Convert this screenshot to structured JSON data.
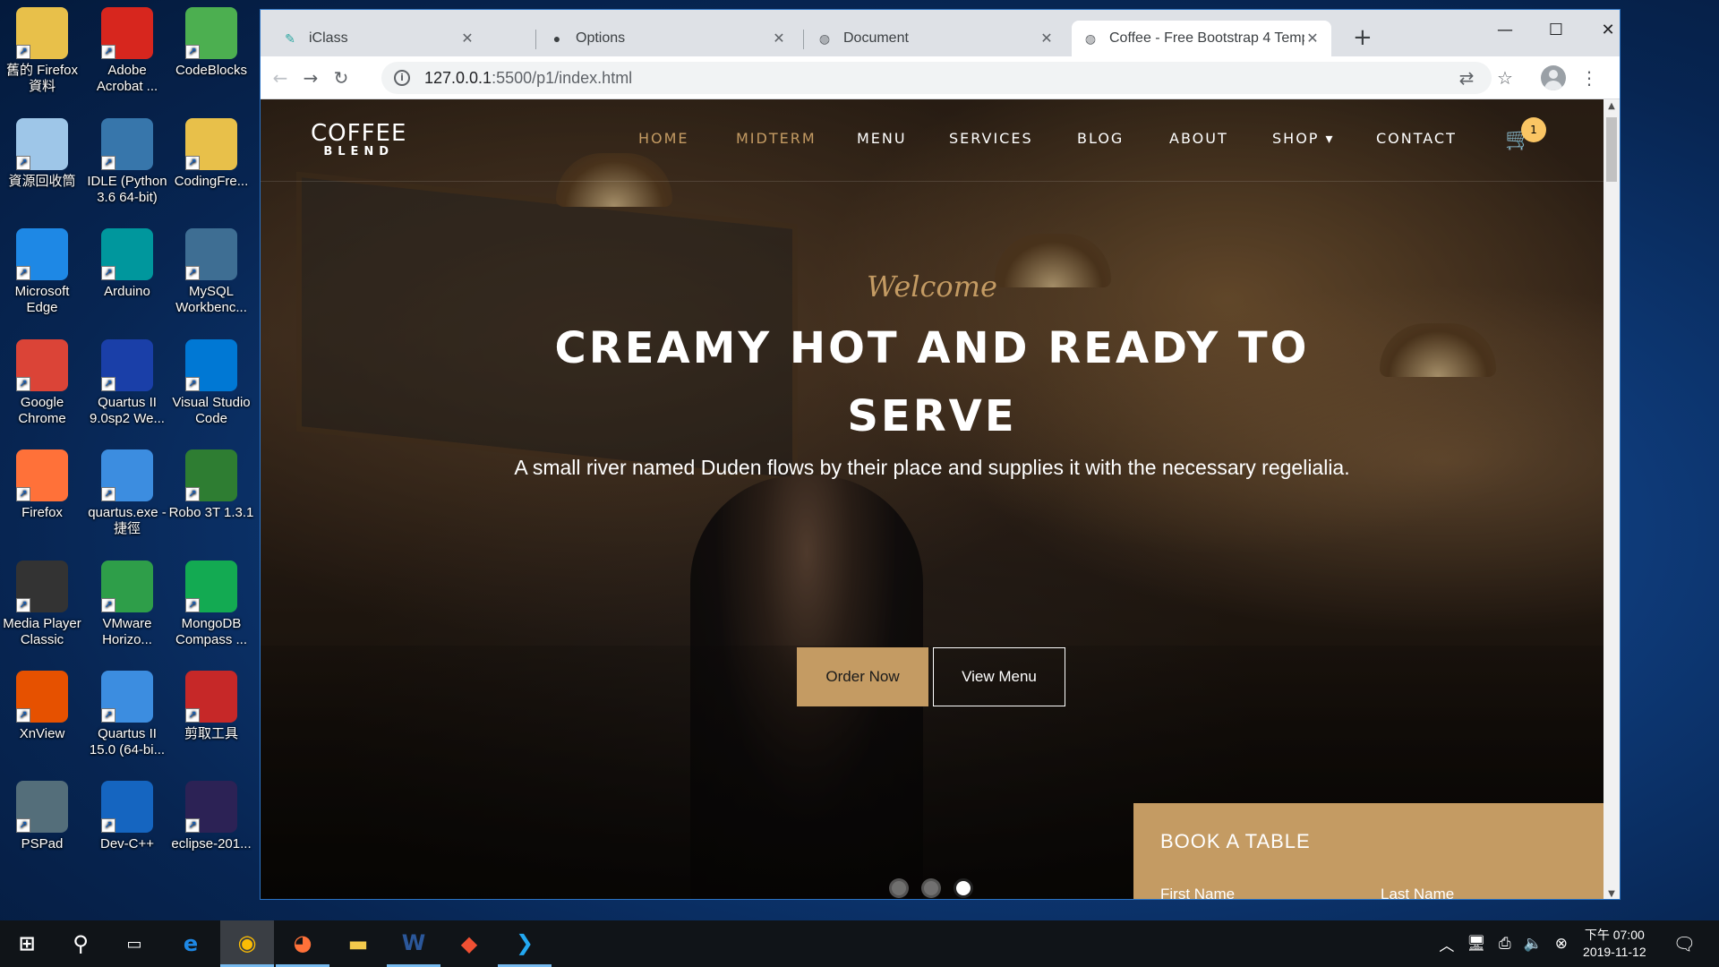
{
  "desktop": {
    "icons": [
      {
        "label": "舊的 Firefox 資料",
        "icon": "folder-icon",
        "color": "#e8c04a"
      },
      {
        "label": "Adobe Acrobat ...",
        "icon": "acrobat-icon",
        "color": "#d7261e"
      },
      {
        "label": "CodeBlocks",
        "icon": "codeblocks-icon",
        "color": "#4caf50"
      },
      {
        "label": "資源回收筒",
        "icon": "recycle-bin-icon",
        "color": "#9ec6e8"
      },
      {
        "label": "IDLE (Python 3.6 64-bit)",
        "icon": "python-icon",
        "color": "#3776ab"
      },
      {
        "label": "CodingFre...",
        "icon": "folder-icon",
        "color": "#e8c04a"
      },
      {
        "label": "Microsoft Edge",
        "icon": "edge-icon",
        "color": "#1e88e5"
      },
      {
        "label": "Arduino",
        "icon": "arduino-icon",
        "color": "#00979d"
      },
      {
        "label": "MySQL Workbenc...",
        "icon": "mysql-icon",
        "color": "#3e6e93"
      },
      {
        "label": "Google Chrome",
        "icon": "chrome-icon",
        "color": "#db4437"
      },
      {
        "label": "Quartus II 9.0sp2 We...",
        "icon": "quartus-icon",
        "color": "#1a3fa8"
      },
      {
        "label": "Visual Studio Code",
        "icon": "vscode-icon",
        "color": "#0078d4"
      },
      {
        "label": "Firefox",
        "icon": "firefox-icon",
        "color": "#ff7139"
      },
      {
        "label": "quartus.exe - 捷徑",
        "icon": "quartus-icon",
        "color": "#3c8de0"
      },
      {
        "label": "Robo 3T 1.3.1",
        "icon": "robo3t-icon",
        "color": "#2e7d32"
      },
      {
        "label": "Media Player Classic",
        "icon": "media-player-icon",
        "color": "#333333"
      },
      {
        "label": "VMware Horizo...",
        "icon": "vmware-icon",
        "color": "#2e9e49"
      },
      {
        "label": "MongoDB Compass ...",
        "icon": "mongodb-icon",
        "color": "#13aa52"
      },
      {
        "label": "XnView",
        "icon": "xnview-icon",
        "color": "#e65100"
      },
      {
        "label": "Quartus II 15.0 (64-bi...",
        "icon": "quartus-icon",
        "color": "#3c8de0"
      },
      {
        "label": "剪取工具",
        "icon": "snipping-tool-icon",
        "color": "#c62828"
      },
      {
        "label": "PSPad",
        "icon": "pspad-icon",
        "color": "#546e7a"
      },
      {
        "label": "Dev-C++",
        "icon": "devcpp-icon",
        "color": "#1565c0"
      },
      {
        "label": "eclipse-201...",
        "icon": "eclipse-icon",
        "color": "#2c2255"
      }
    ]
  },
  "browser": {
    "tabs": [
      {
        "title": "iClass",
        "icon": "iclass-icon"
      },
      {
        "title": "Options",
        "icon": "github-icon"
      },
      {
        "title": "Document",
        "icon": "globe-icon"
      },
      {
        "title": "Coffee - Free Bootstrap 4 Temp",
        "icon": "globe-icon",
        "active": true
      }
    ],
    "url_host": "127.0.0.1",
    "url_path": ":5500/p1/index.html"
  },
  "site": {
    "brand_top": "COFFEE",
    "brand_bottom": "BLEND",
    "nav": [
      {
        "label": "HOME",
        "active": true
      },
      {
        "label": "MIDTERM",
        "active": true
      },
      {
        "label": "MENU"
      },
      {
        "label": "SERVICES"
      },
      {
        "label": "BLOG"
      },
      {
        "label": "ABOUT"
      },
      {
        "label": "SHOP ▾"
      },
      {
        "label": "CONTACT"
      }
    ],
    "cart_count": "1",
    "accent_color": "#c49b63",
    "hero": {
      "welcome": "Welcome",
      "headline": "CREAMY HOT AND READY TO SERVE",
      "subtitle": "A small river named Duden flows by their place and supplies it with the necessary regelialia.",
      "order_button": "Order Now",
      "menu_button": "View Menu",
      "slide_count": 3,
      "active_slide": 3
    },
    "book_table": {
      "title": "BOOK A TABLE",
      "first_name_label": "First Name",
      "last_name_label": "Last Name"
    }
  },
  "taskbar": {
    "clock_time": "下午 07:00",
    "clock_date": "2019-11-12"
  }
}
